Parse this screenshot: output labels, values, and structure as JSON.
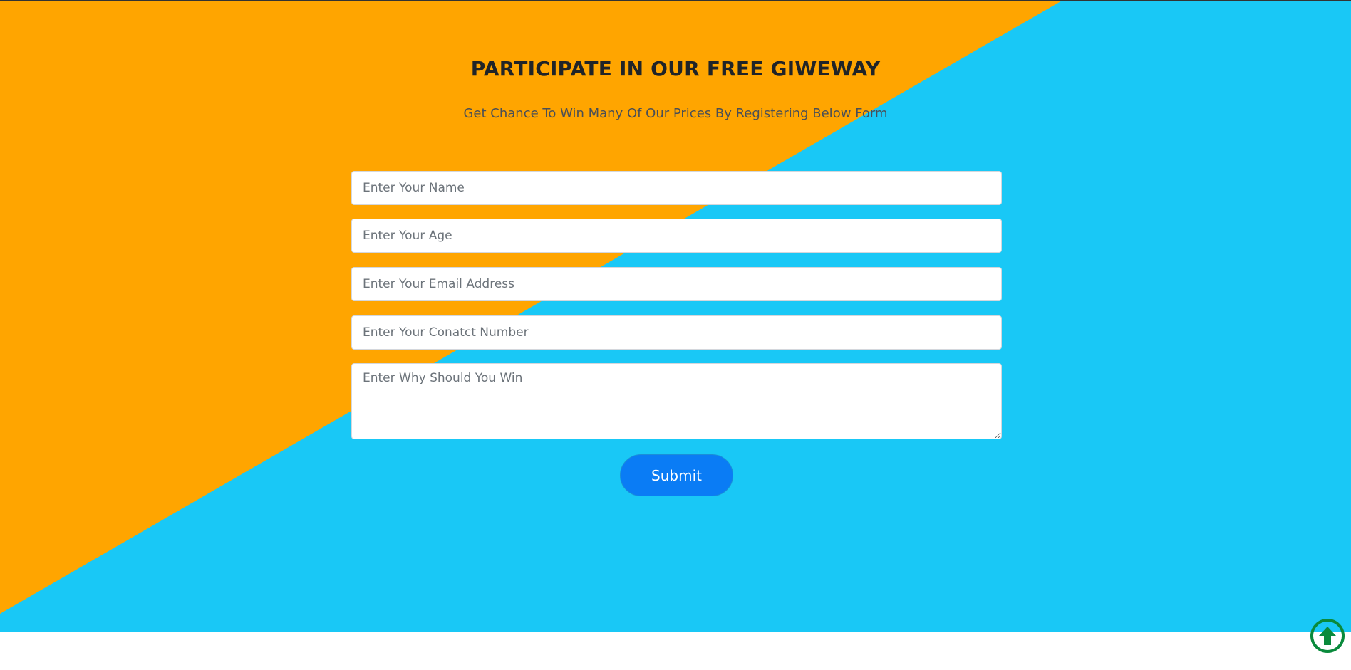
{
  "page": {
    "title": "PARTICIPATE IN OUR FREE GIWEWAY",
    "subtitle": "Get Chance To Win Many Of Our Prices By Registering Below Form"
  },
  "form": {
    "name_placeholder": "Enter Your Name",
    "age_placeholder": "Enter Your Age",
    "email_placeholder": "Enter Your Email Address",
    "contact_placeholder": "Enter Your Conatct Number",
    "reason_placeholder": "Enter Why Should You Win",
    "submit_label": "Submit"
  },
  "colors": {
    "background_blue": "#19c8f6",
    "background_orange": "#ffa500",
    "button_blue": "#0a7cf5",
    "scroll_icon_green": "#0a8a3c"
  },
  "icons": {
    "scroll_top": "arrow-up-circle-icon"
  }
}
